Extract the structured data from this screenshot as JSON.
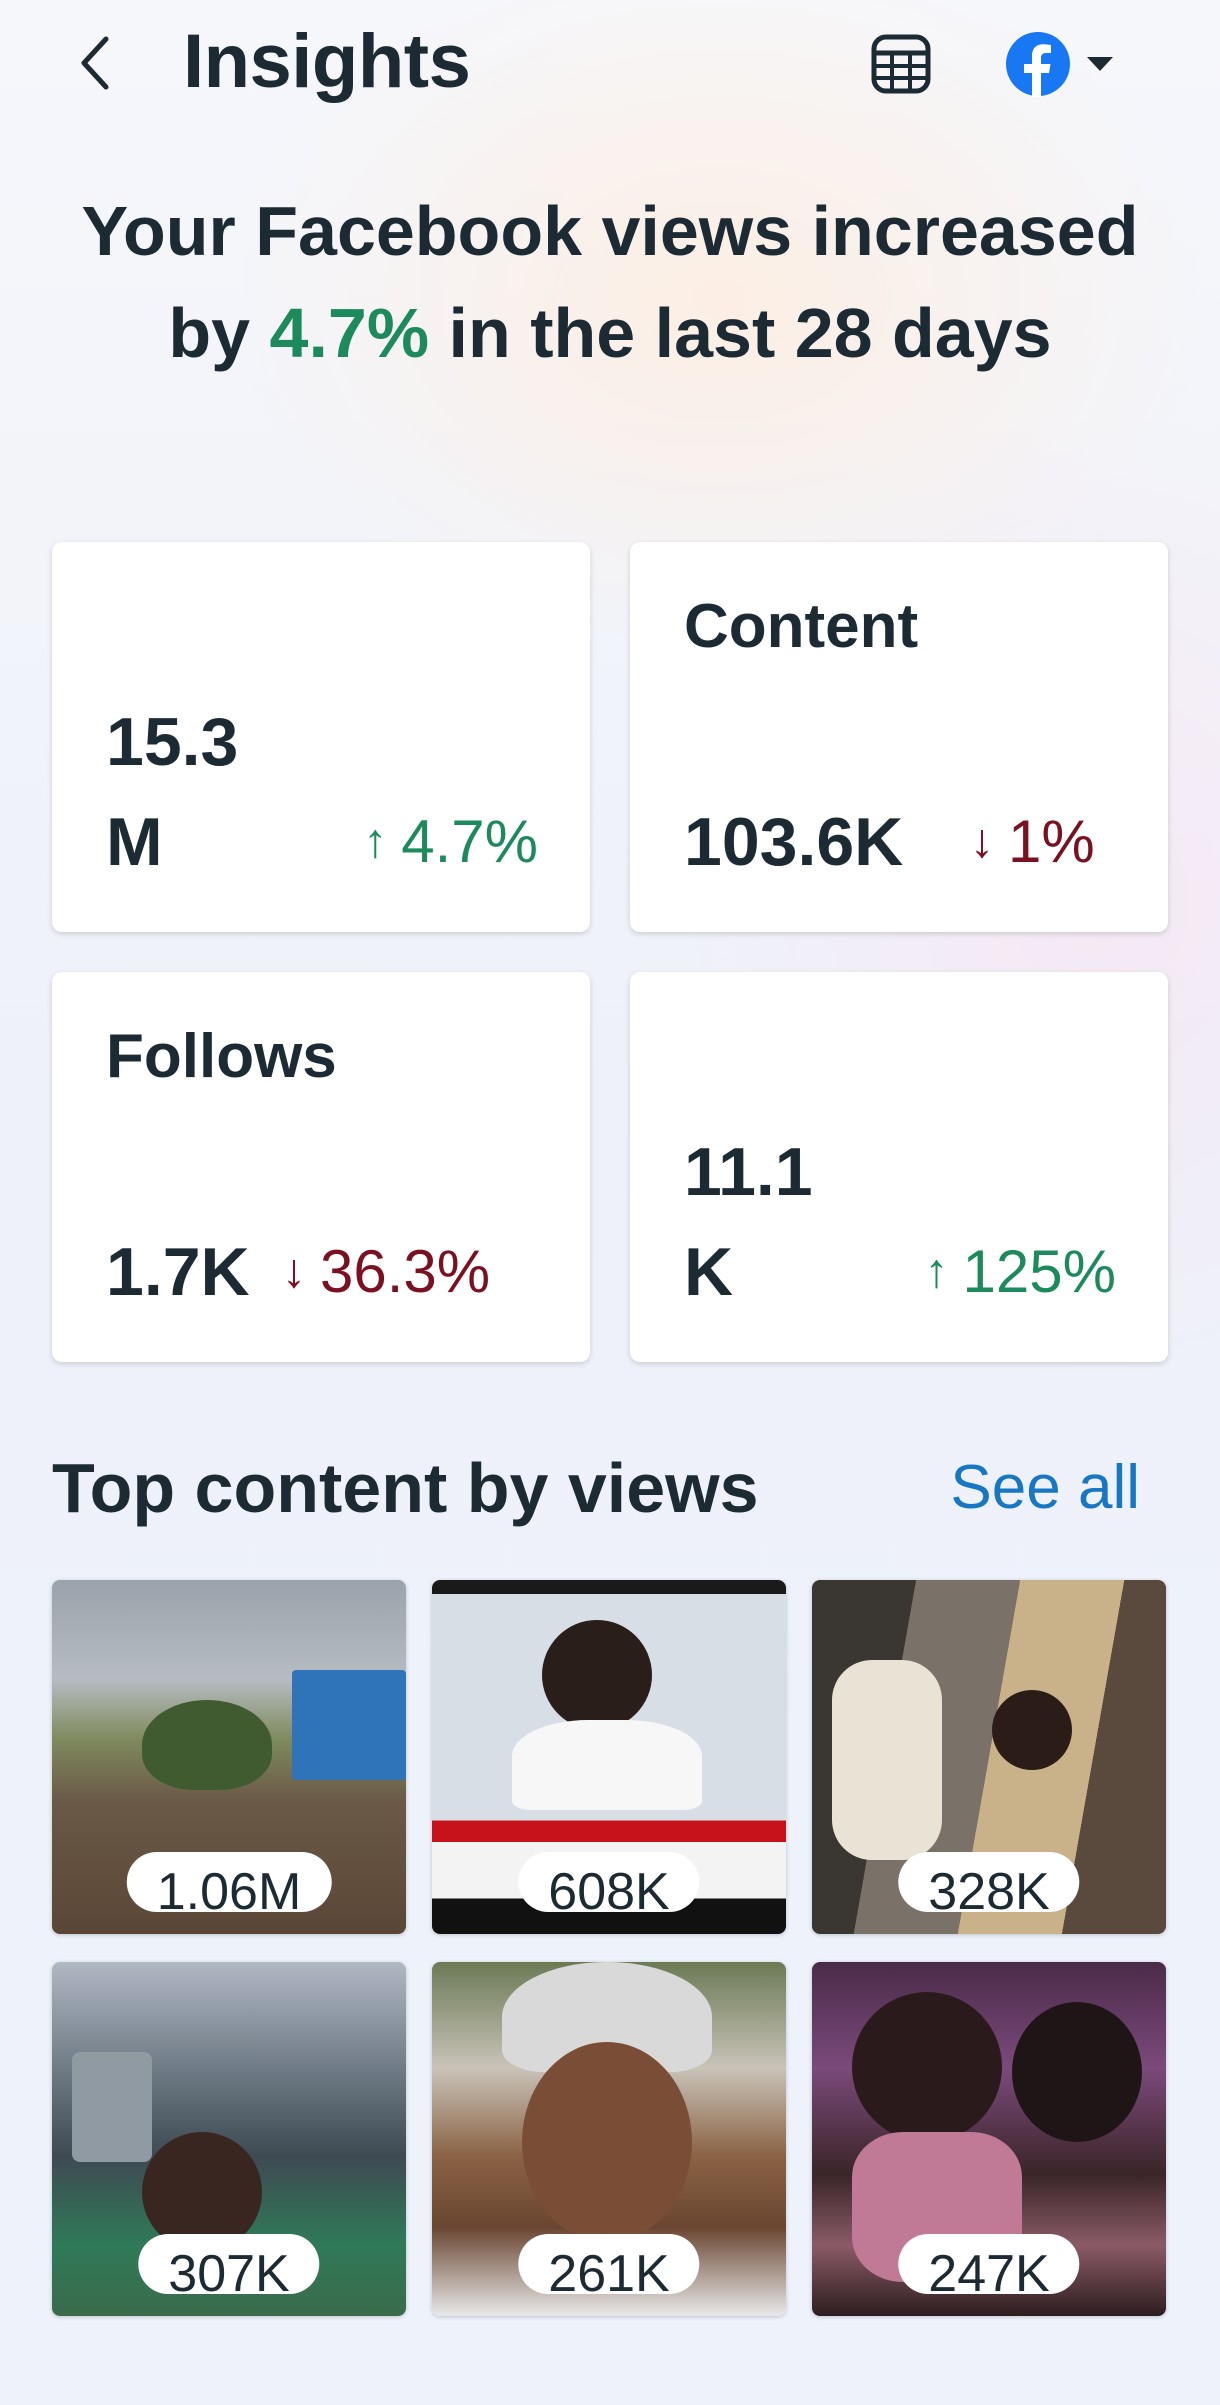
{
  "header": {
    "title": "Insights",
    "back_icon": "chevron-left-icon",
    "table_icon": "table-icon",
    "platform_icon": "facebook-logo-icon",
    "dropdown_icon": "caret-down-icon"
  },
  "headline": {
    "part1": "Your Facebook views increased by ",
    "accent": "4.7%",
    "part2": " in the last 28 days"
  },
  "metrics": [
    {
      "label": "",
      "value": "15.3 M",
      "delta": "4.7%",
      "direction": "up"
    },
    {
      "label": "Content",
      "value": "103.6K",
      "delta": "1%",
      "direction": "down"
    },
    {
      "label": "Follows",
      "value": "1.7K",
      "delta": "36.3%",
      "direction": "down"
    },
    {
      "label": "",
      "value": "11.1 K",
      "delta": "125%",
      "direction": "up"
    }
  ],
  "arrows": {
    "up": "↑",
    "down": "↓"
  },
  "top_content": {
    "title": "Top content by views",
    "see_all": "See all",
    "items": [
      {
        "views": "1.06M"
      },
      {
        "views": "608K"
      },
      {
        "views": "328K"
      },
      {
        "views": "307K"
      },
      {
        "views": "261K"
      },
      {
        "views": "247K"
      }
    ]
  },
  "colors": {
    "positive": "#1d8a5b",
    "negative": "#7a1020",
    "link": "#1877c2",
    "facebook_blue": "#1877f2"
  }
}
